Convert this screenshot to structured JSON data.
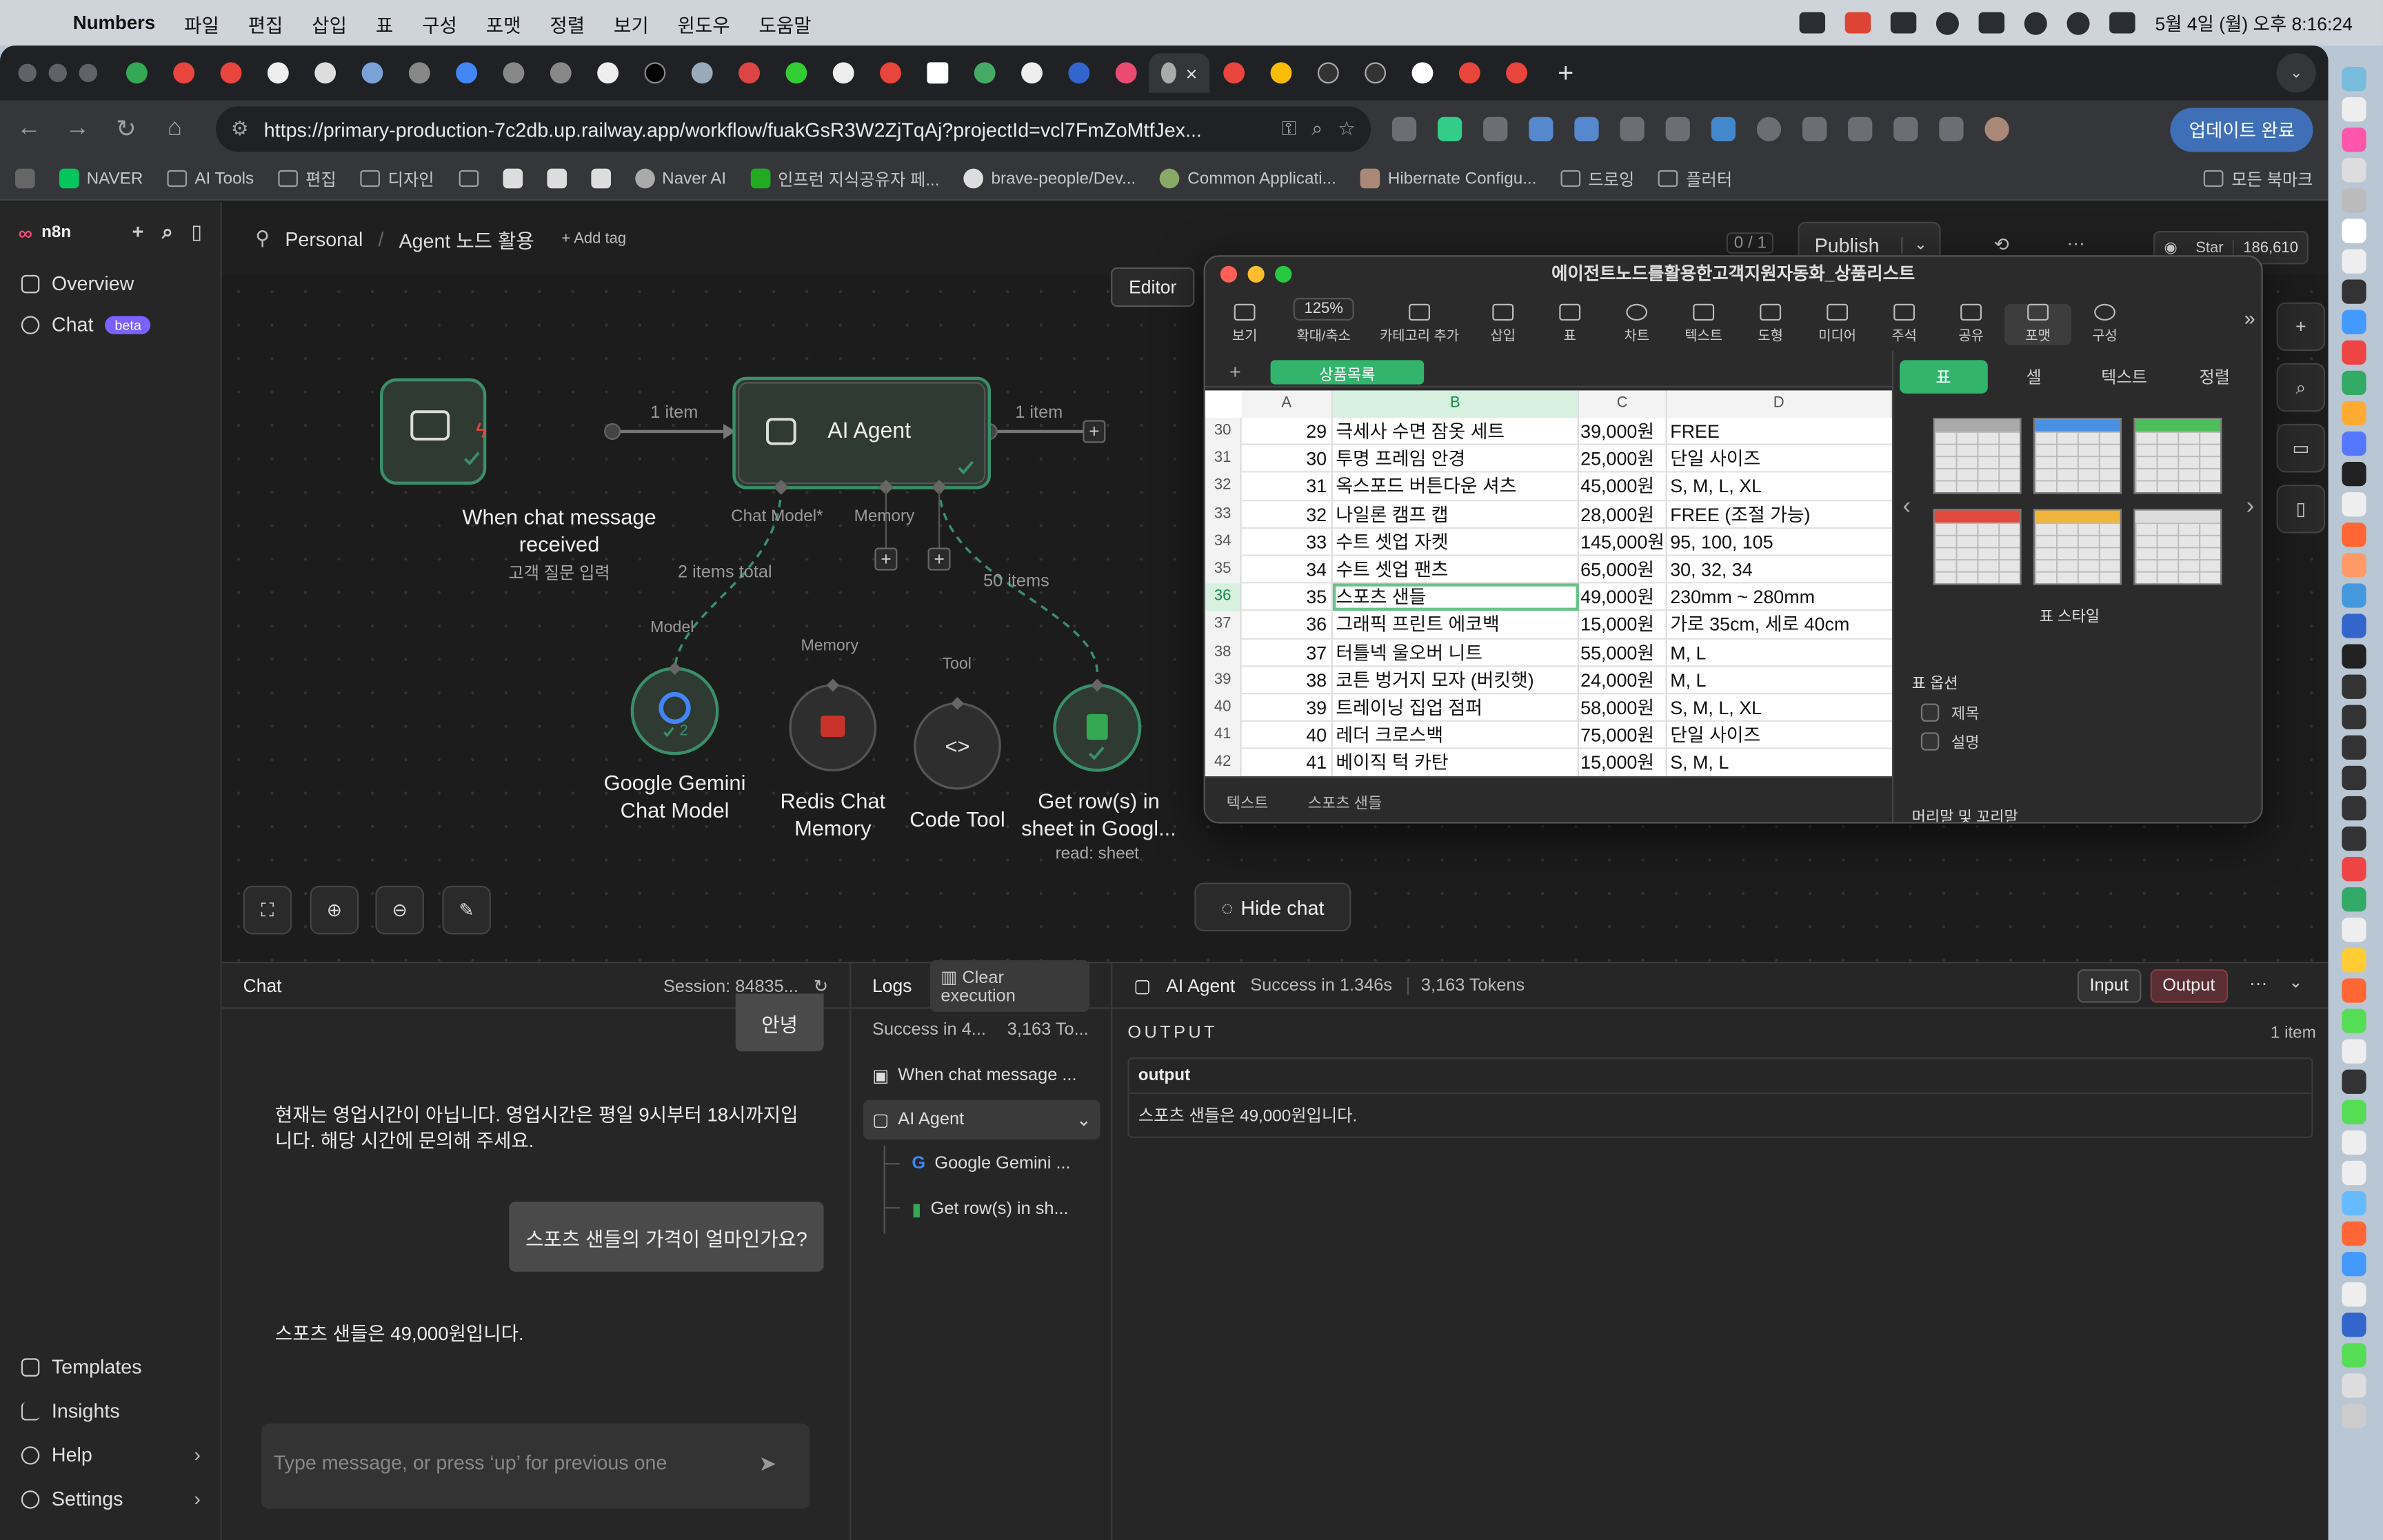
{
  "menubar": {
    "app": "Numbers",
    "items": [
      "파일",
      "편집",
      "삽입",
      "표",
      "구성",
      "포맷",
      "정렬",
      "보기",
      "윈도우",
      "도움말"
    ],
    "clock": "5월 4일 (월) 오후 8:16:24"
  },
  "browser": {
    "url": "https://primary-production-7c2db.up.railway.app/workflow/fuakGsR3W2ZjTqAj?projectId=vcl7FmZoMtfJex...",
    "update_label": "업데이트 완료",
    "bookmarks": [
      "NAVER",
      "AI Tools",
      "편집",
      "디자인",
      "Naver AI",
      "인프런 지식공유자 페...",
      "brave-people/Dev...",
      "Common Applicati...",
      "Hibernate Configu...",
      "드로잉",
      "플러터",
      "모든 북마크"
    ]
  },
  "n8n": {
    "logo": "n8n",
    "sidebar": {
      "overview": "Overview",
      "chat": "Chat",
      "beta": "beta",
      "templates": "Templates",
      "insights": "Insights",
      "help": "Help",
      "settings": "Settings"
    },
    "breadcrumb": {
      "project": "Personal",
      "workflow": "Agent 노드 활용",
      "add_tag": "+ Add tag"
    },
    "counter": "0 / 1",
    "publish": "Publish",
    "github": {
      "label": "Star",
      "count": "186,610"
    },
    "editor_tab": "Editor",
    "nodes": {
      "trigger": {
        "title": "When chat message received",
        "subtitle": "고객 질문 입력"
      },
      "agent": {
        "title": "AI Agent"
      },
      "gemini": {
        "title": "Google Gemini Chat Model",
        "badge": "2"
      },
      "redis": {
        "title": "Redis Chat Memory"
      },
      "code": {
        "title": "Code Tool"
      },
      "sheets": {
        "title": "Get row(s) in sheet in Googl...",
        "subtitle": "read: sheet"
      }
    },
    "edges": {
      "trigger_agent": "1 item",
      "agent_out": "1 item",
      "model_total": "2 items total",
      "tool_items": "50 items",
      "port_model": "Chat Model*",
      "port_memory": "Memory",
      "port_tool": "Tool",
      "lbl_model": "Model",
      "lbl_memory": "Memory",
      "lbl_tool": "Tool"
    },
    "hide_chat": "Hide chat",
    "chat": {
      "title": "Chat",
      "session": "Session: 84835...",
      "messages": [
        {
          "role": "user",
          "text": "안녕"
        },
        {
          "role": "bot",
          "text": "현재는 영업시간이 아닙니다. 영업시간은 평일 9시부터 18시까지입니다. 해당 시간에 문의해 주세요."
        },
        {
          "role": "user",
          "text": "스포츠 샌들의 가격이 얼마인가요?"
        },
        {
          "role": "bot",
          "text": "스포츠 샌들은 49,000원입니다."
        }
      ],
      "placeholder": "Type message, or press ‘up’ for previous one"
    },
    "logs": {
      "title": "Logs",
      "clear": "Clear execution",
      "summary_a": "Success in 4...",
      "summary_b": "3,163 To...",
      "rows": [
        "When chat message ...",
        "AI Agent",
        "Google Gemini ...",
        "Get row(s) in sh..."
      ]
    },
    "output": {
      "node": "AI Agent",
      "status": "Success in 1.346s",
      "tokens": "3,163 Tokens",
      "input_btn": "Input",
      "output_btn": "Output",
      "heading": "OUTPUT",
      "count": "1 item",
      "col": "output",
      "value": "스포츠 샌들은 49,000원입니다."
    }
  },
  "numbers": {
    "title": "에이전트노드를활용한고객지원자동화_상품리스트",
    "zoom": "125%",
    "toolbar": [
      "보기",
      "확대/축소",
      "카테고리 추가",
      "삽입",
      "표",
      "차트",
      "텍스트",
      "도형",
      "미디어",
      "주석",
      "공유",
      "포맷",
      "구성"
    ],
    "sheet": "상품목록",
    "columns": [
      "A",
      "B",
      "C",
      "D"
    ],
    "rows": [
      {
        "r": "30",
        "a": "29",
        "b": "극세사 수면 잠옷 세트",
        "c": "39,000원",
        "d": "FREE"
      },
      {
        "r": "31",
        "a": "30",
        "b": "투명 프레임 안경",
        "c": "25,000원",
        "d": "단일 사이즈"
      },
      {
        "r": "32",
        "a": "31",
        "b": "옥스포드 버튼다운 셔츠",
        "c": "45,000원",
        "d": "S, M, L, XL"
      },
      {
        "r": "33",
        "a": "32",
        "b": "나일론 캠프 캡",
        "c": "28,000원",
        "d": "FREE (조절 가능)"
      },
      {
        "r": "34",
        "a": "33",
        "b": "수트 셋업 자켓",
        "c": "145,000원",
        "d": "95, 100, 105"
      },
      {
        "r": "35",
        "a": "34",
        "b": "수트 셋업 팬츠",
        "c": "65,000원",
        "d": "30, 32, 34"
      },
      {
        "r": "36",
        "a": "35",
        "b": "스포츠 샌들",
        "c": "49,000원",
        "d": "230mm ~ 280mm"
      },
      {
        "r": "37",
        "a": "36",
        "b": "그래픽 프린트 에코백",
        "c": "15,000원",
        "d": "가로 35cm, 세로 40cm"
      },
      {
        "r": "38",
        "a": "37",
        "b": "터틀넥 울오버 니트",
        "c": "55,000원",
        "d": "M, L"
      },
      {
        "r": "39",
        "a": "38",
        "b": "코튼 벙거지 모자 (버킷햇)",
        "c": "24,000원",
        "d": "M, L"
      },
      {
        "r": "40",
        "a": "39",
        "b": "트레이닝 집업 점퍼",
        "c": "58,000원",
        "d": "S, M, L, XL"
      },
      {
        "r": "41",
        "a": "40",
        "b": "레더 크로스백",
        "c": "75,000원",
        "d": "단일 사이즈"
      },
      {
        "r": "42",
        "a": "41",
        "b": "베이직 턱 카탄",
        "c": "15,000원",
        "d": "S, M, L"
      }
    ],
    "footer": [
      "텍스트",
      "스포츠 샌들"
    ],
    "format": {
      "tabs": [
        "표",
        "셀",
        "텍스트",
        "정렬"
      ],
      "style_label": "표 스타일",
      "options_label": "표 옵션",
      "opt_title": "제목",
      "opt_caption": "설명",
      "header_footer": "머리말 및 꼬리말"
    }
  }
}
